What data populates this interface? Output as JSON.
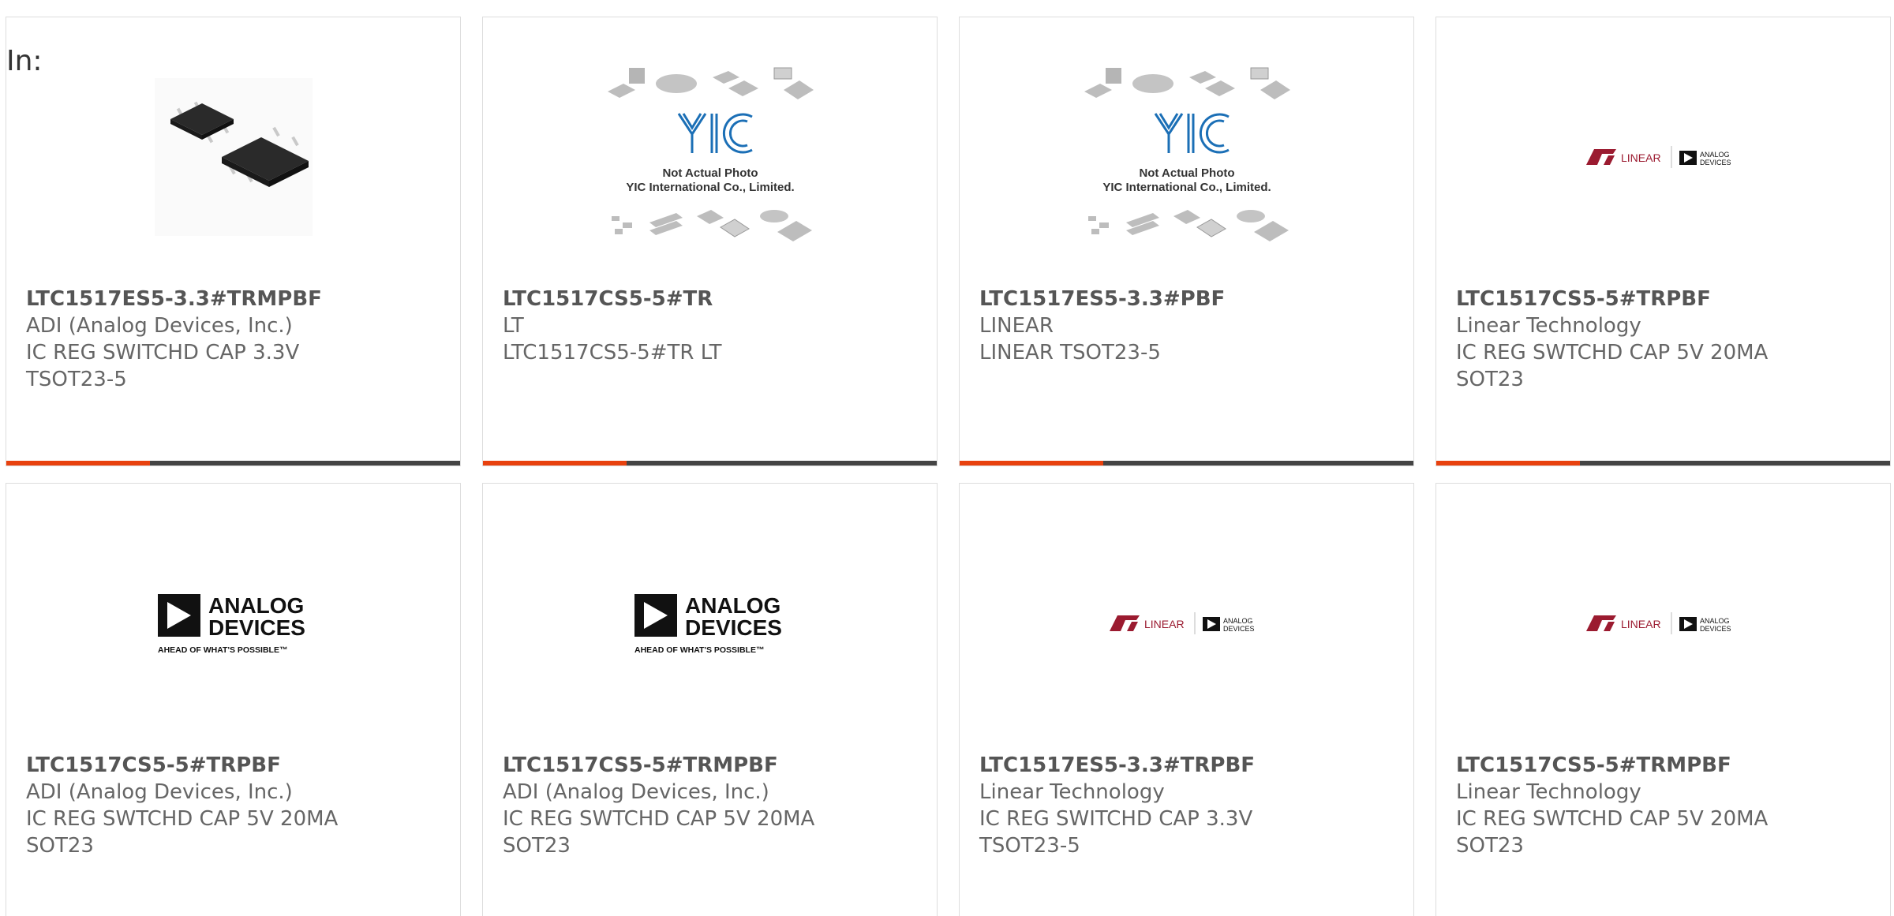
{
  "page": {
    "in_label": "In:"
  },
  "colors": {
    "accent": "#e8410e",
    "bar": "#444444",
    "border": "#dddddd"
  },
  "yic": {
    "line1": "Not Actual Photo",
    "line2": "YIC International Co., Limited.",
    "mark": "YIC"
  },
  "adi_logo": {
    "top": "ANALOG",
    "bottom": "DEVICES",
    "tagline": "AHEAD OF WHAT'S POSSIBLE™"
  },
  "lt_logo": {
    "name": "LINEAR",
    "sub1": "ANALOG",
    "sub2": "DEVICES"
  },
  "products": [
    {
      "part": "LTC1517ES5-3.3#TRMPBF",
      "maker": "ADI (Analog Devices, Inc.)",
      "desc1": "IC REG SWITCHD CAP 3.3V",
      "desc2": "TSOT23-5",
      "image": "chip-photo"
    },
    {
      "part": "LTC1517CS5-5#TR",
      "maker": "LT",
      "desc1": "LTC1517CS5-5#TR LT",
      "desc2": "",
      "image": "yic-placeholder"
    },
    {
      "part": "LTC1517ES5-3.3#PBF",
      "maker": "LINEAR",
      "desc1": "LINEAR TSOT23-5",
      "desc2": "",
      "image": "yic-placeholder"
    },
    {
      "part": "LTC1517CS5-5#TRPBF",
      "maker": "Linear Technology",
      "desc1": "IC REG SWTCHD CAP 5V 20MA",
      "desc2": "SOT23",
      "image": "linear-logo"
    },
    {
      "part": "LTC1517CS5-5#TRPBF",
      "maker": "ADI (Analog Devices, Inc.)",
      "desc1": "IC REG SWTCHD CAP 5V 20MA",
      "desc2": "SOT23",
      "image": "analog-devices-logo"
    },
    {
      "part": "LTC1517CS5-5#TRMPBF",
      "maker": "ADI (Analog Devices, Inc.)",
      "desc1": "IC REG SWTCHD CAP 5V 20MA",
      "desc2": "SOT23",
      "image": "analog-devices-logo"
    },
    {
      "part": "LTC1517ES5-3.3#TRPBF",
      "maker": "Linear Technology",
      "desc1": "IC REG SWITCHD CAP 3.3V",
      "desc2": "TSOT23-5",
      "image": "linear-logo"
    },
    {
      "part": "LTC1517CS5-5#TRMPBF",
      "maker": "Linear Technology",
      "desc1": "IC REG SWTCHD CAP 5V 20MA",
      "desc2": "SOT23",
      "image": "linear-logo"
    }
  ]
}
